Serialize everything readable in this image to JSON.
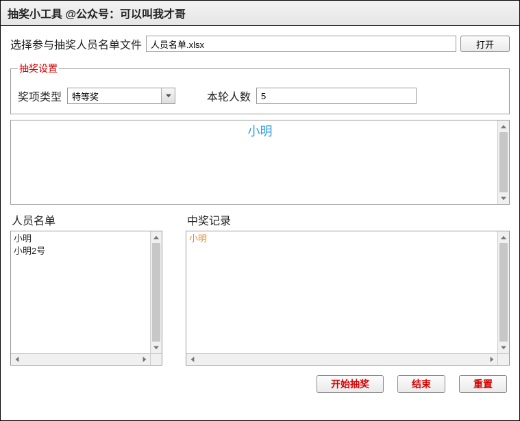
{
  "window_title": "抽奖小工具 @公众号：可以叫我才哥",
  "file_section": {
    "label": "选择参与抽奖人员名单文件",
    "value": "人员名单.xlsx",
    "open_button": "打开"
  },
  "settings": {
    "legend": "抽奖设置",
    "prize_type_label": "奖项类型",
    "prize_type_value": "特等奖",
    "round_count_label": "本轮人数",
    "round_count_value": "5"
  },
  "current_display": "小明",
  "name_list": {
    "title": "人员名单",
    "items": [
      "小明",
      "小明2号"
    ]
  },
  "win_records": {
    "title": "中奖记录",
    "items": [
      "小明"
    ]
  },
  "buttons": {
    "start": "开始抽奖",
    "end": "结束",
    "reset": "重置"
  }
}
